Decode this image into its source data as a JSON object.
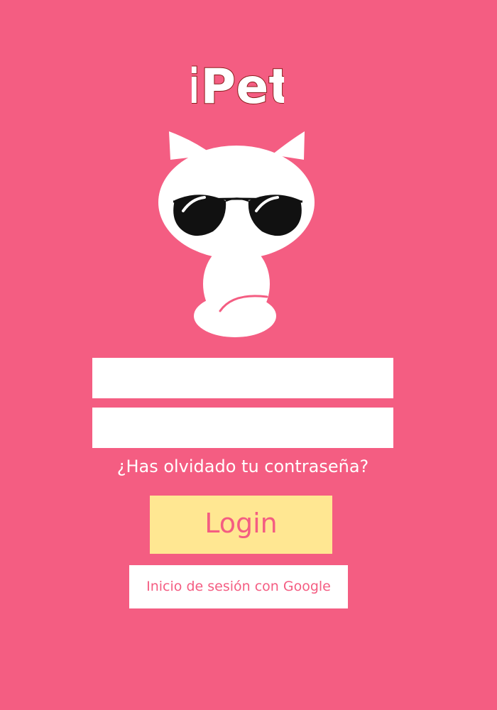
{
  "app": {
    "name": "iPet"
  },
  "colors": {
    "background": "#F45D82",
    "login_button": "#FFE792",
    "accent_text": "#F45D82",
    "field_background": "#FFFFFF"
  },
  "mascot": {
    "icon": "cat-with-sunglasses-icon"
  },
  "form": {
    "username_value": "",
    "password_value": "",
    "forgot_password": "¿Has olvidado tu contraseña?",
    "login_label": "Login",
    "google_label": "Inicio de sesión con Google"
  }
}
